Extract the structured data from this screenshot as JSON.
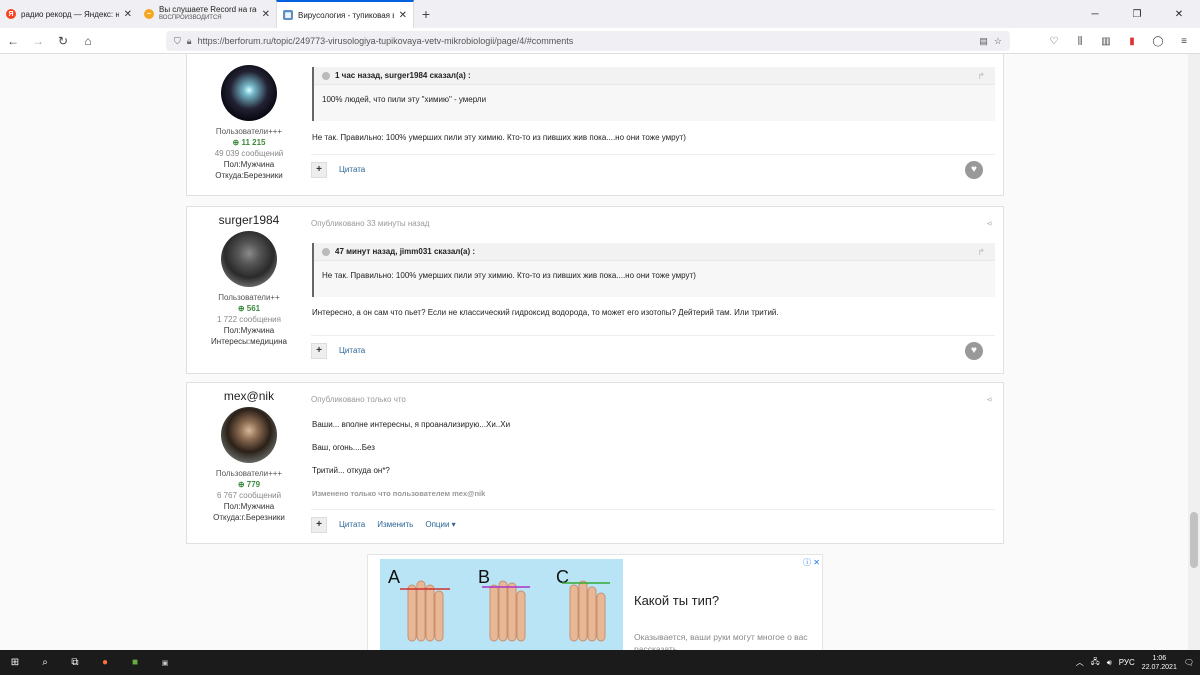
{
  "browser": {
    "tabs": [
      {
        "title": "радио рекорд — Яндекс: нашлось",
        "subtitle": "",
        "active": false,
        "icon": "yandex-icon"
      },
      {
        "title": "Вы слушаете Record на radiorecord",
        "subtitle": "ВОСПРОИЗВОДИТСЯ",
        "active": false,
        "icon": "record-icon"
      },
      {
        "title": "Вирусология - тупиковая ветвь",
        "subtitle": "",
        "active": true,
        "icon": "forum-icon"
      }
    ],
    "url": "https://berforum.ru/topic/249773-virusologiya-tupikovaya-vetv-mikrobiologii/page/4/#comments"
  },
  "posts": [
    {
      "author": {
        "name": "",
        "rank": "Пользователи+++",
        "rep": "11 215",
        "count": "49 039 сообщений",
        "lines": [
          "Пол:Мужчина",
          "Откуда:Березники"
        ]
      },
      "meta": "",
      "quote": {
        "header": "1 час назад, surger1984 сказал(а) :",
        "body": "100% людей, что пили эту \"химию\" - умерли"
      },
      "text": [
        "Не так. Правильно: 100% умерших пили эту химию. Кто-то из пивших жив пока....но они тоже умрут)"
      ],
      "actions": [
        "Цитата"
      ]
    },
    {
      "author": {
        "name": "surger1984",
        "rank": "Пользователи++",
        "rep": "561",
        "count": "1 722 сообщения",
        "lines": [
          "Пол:Мужчина",
          "Интересы:медицина"
        ]
      },
      "meta": "Опубликовано 33 минуты назад",
      "quote": {
        "header": "47 минут назад, jimm031 сказал(а) :",
        "body": "Не так. Правильно: 100% умерших пили эту химию. Кто-то из пивших жив пока....но они тоже умрут)"
      },
      "text": [
        "Интересно, а он сам что пьет? Если не классический гидроксид водорода, то может его изотопы? Дейтерий там. Или тритий."
      ],
      "actions": [
        "Цитата"
      ]
    },
    {
      "author": {
        "name": "mex@nik",
        "rank": "Пользователи+++",
        "rep": "779",
        "count": "6 767 сообщений",
        "lines": [
          "Пол:Мужчина",
          "Откуда:г.Березники"
        ]
      },
      "meta": "Опубликовано только что",
      "text": [
        "Ваши... вполне интересны, я проанализирую...Хи..Хи",
        "Ваш, огонь....Без",
        "Тритий... откуда он*?"
      ],
      "edited": "Изменено только что пользователем mex@nik",
      "actions": [
        "Цитата",
        "Изменить",
        "Опции ▾"
      ]
    }
  ],
  "ad": {
    "headline": "Какой ты тип?",
    "subtext": "Оказывается, ваши руки могут многое о вас рассказать",
    "labels": [
      "A",
      "B",
      "C"
    ]
  },
  "taskbar": {
    "lang": "РУС",
    "time": "1:06",
    "date": "22.07.2021"
  }
}
